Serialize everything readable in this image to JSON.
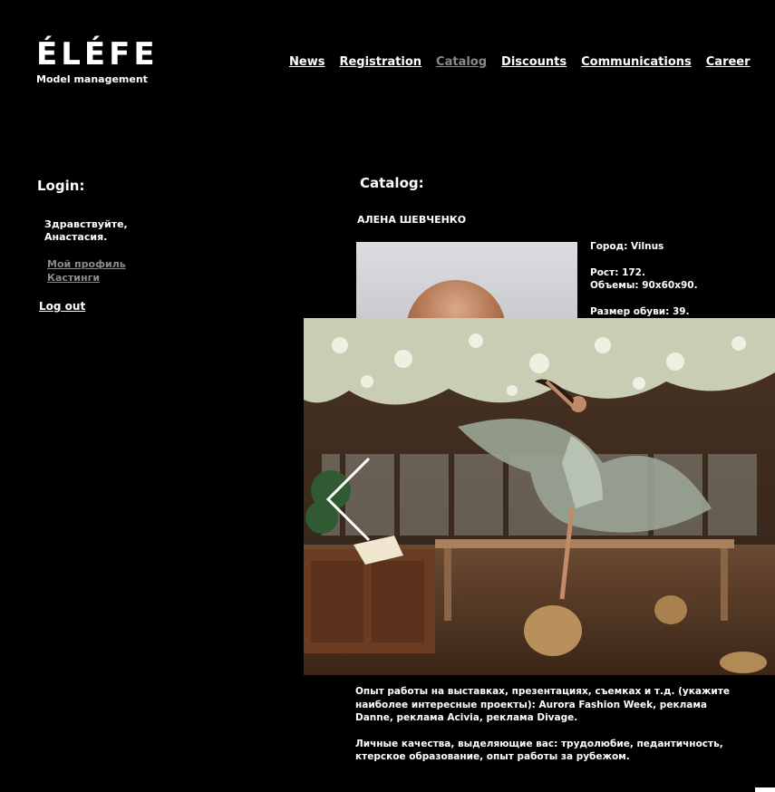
{
  "logo": {
    "title": "ÉLÉFE",
    "subtitle": "Model management"
  },
  "nav": {
    "items": [
      {
        "label": "News"
      },
      {
        "label": "Registration"
      },
      {
        "label": "Catalog",
        "active": true
      },
      {
        "label": "Discounts"
      },
      {
        "label": "Communications"
      },
      {
        "label": "Career"
      }
    ]
  },
  "sidebar": {
    "login_heading": "Login:",
    "greeting": "Здравствуйте, Анастасия.",
    "links": [
      "Мой профиль",
      "Кастинги"
    ],
    "logout": "Log out"
  },
  "catalog": {
    "heading": "Catalog:",
    "model_name": "АЛЕНА ШЕВЧЕНКО",
    "city": "Город: Vilnus",
    "height": "Рост: 172.",
    "measurements": "Объемы: 90х60х90.",
    "shoe_size": "Размер обуви: 39.",
    "experience": "Опыт работы на выставках, презентациях, съемках и т.д. (укажите наиболее интересные проекты): Aurora Fashion Week, реклама Danne, реклама Acivia, реклама Divage.",
    "qualities": "Личные качества,  выделяющие вас: трудолюбие, педантичность, ктерское образование, опыт работы за рубежом."
  },
  "colors": {
    "background": "#000000",
    "text": "#ffffff",
    "muted_link": "#8a8a8a"
  },
  "icons": {
    "prev": "chevron-left-icon"
  }
}
